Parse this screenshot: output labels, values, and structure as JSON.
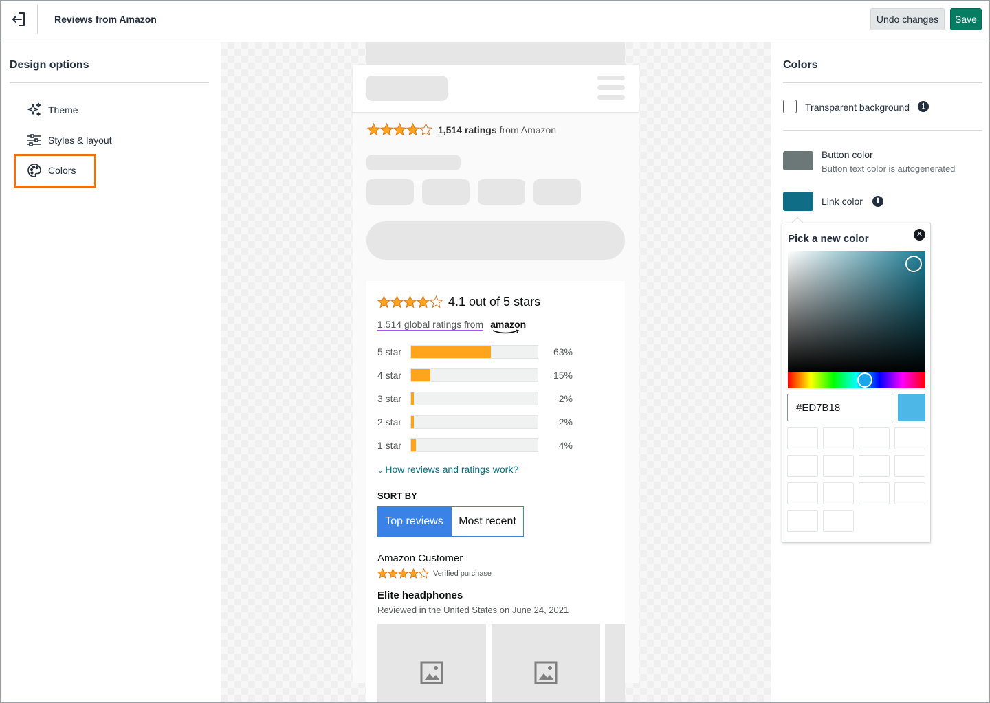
{
  "header": {
    "title": "Reviews from Amazon",
    "undo_label": "Undo changes",
    "save_label": "Save"
  },
  "left_panel": {
    "title": "Design options",
    "items": [
      {
        "label": "Theme",
        "icon": "sparkle-icon"
      },
      {
        "label": "Styles & layout",
        "icon": "sliders-icon"
      },
      {
        "label": "Colors",
        "icon": "palette-icon",
        "selected": true
      }
    ]
  },
  "preview": {
    "mini_rating": {
      "stars": 4,
      "count": "1,514 ratings",
      "source": "from Amazon"
    },
    "widget": {
      "average_text": "4.1 out of 5 stars",
      "average_stars": 4,
      "global_ratings": "1,514 global ratings from",
      "logo_text": "amazon",
      "histogram": [
        {
          "label": "5 star",
          "percent": 63,
          "pct_text": "63%"
        },
        {
          "label": "4 star",
          "percent": 15,
          "pct_text": "15%"
        },
        {
          "label": "3 star",
          "percent": 2,
          "pct_text": "2%"
        },
        {
          "label": "2 star",
          "percent": 2,
          "pct_text": "2%"
        },
        {
          "label": "1 star",
          "percent": 4,
          "pct_text": "4%"
        }
      ],
      "how_link": "How reviews and ratings work?",
      "sort_by_label": "SORT BY",
      "sort_options": [
        "Top reviews",
        "Most recent"
      ],
      "review": {
        "author": "Amazon Customer",
        "stars": 4,
        "verified": "Verified purchase",
        "title": "Elite headphones",
        "date": "Reviewed in the United States on June 24, 2021"
      }
    }
  },
  "right_panel": {
    "title": "Colors",
    "transparent_label": "Transparent background",
    "button_color_label": "Button color",
    "button_color_sub": "Button text color is autogenerated",
    "button_color": "#6c7778",
    "link_color_label": "Link color",
    "link_color": "#0f6e85",
    "picker": {
      "title": "Pick a new color",
      "hex_value": "#ED7B18",
      "preview_color": "#4db8e8"
    }
  },
  "colors": {
    "accent_orange": "#ec7211",
    "save_green": "#067d62",
    "star_orange": "#ffa41c",
    "sort_blue": "#3b82e8"
  }
}
